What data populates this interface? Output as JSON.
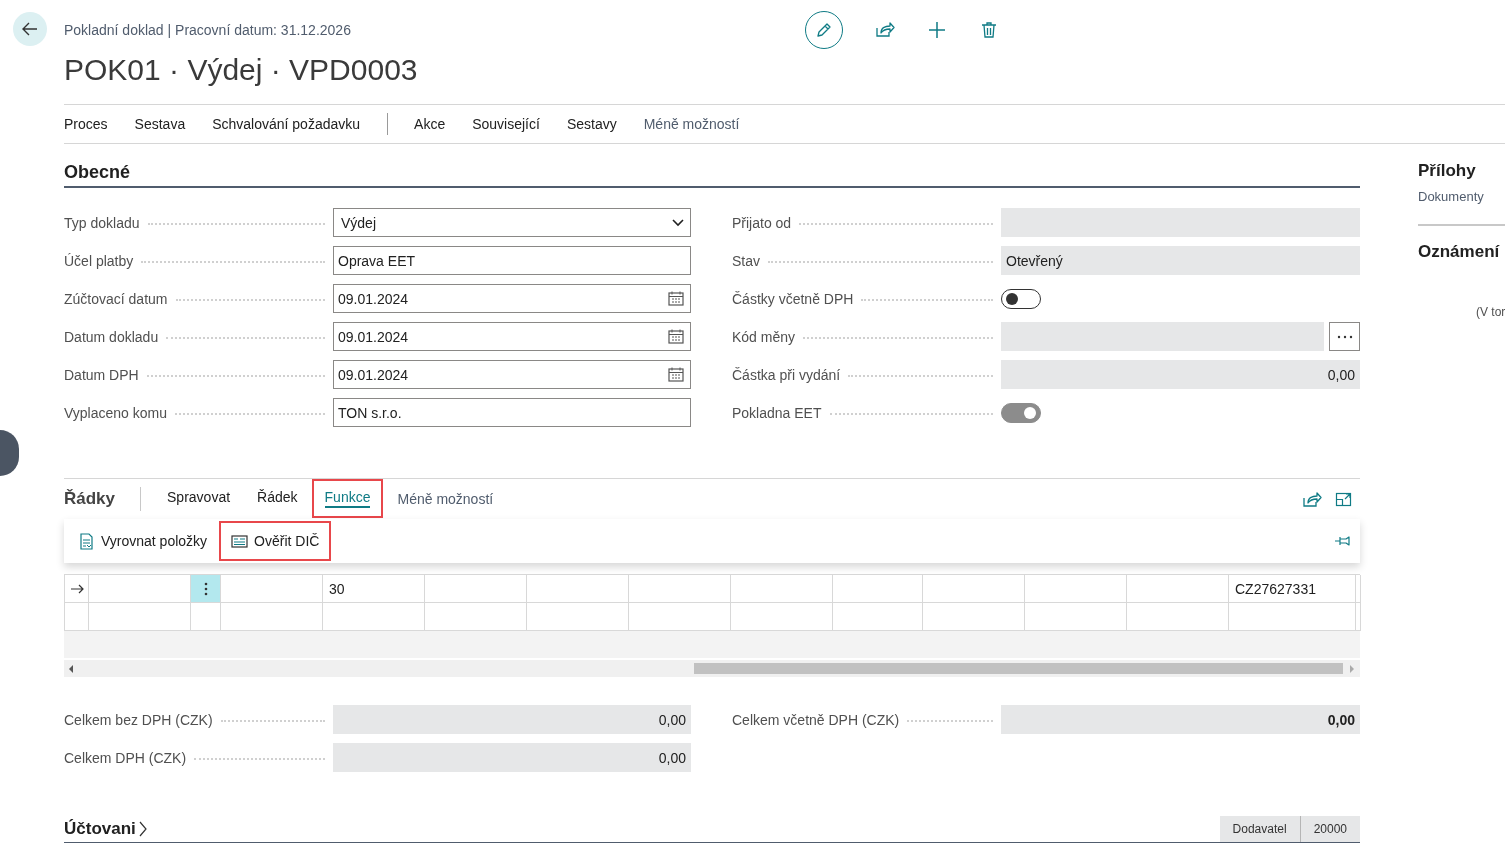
{
  "header": {
    "breadcrumb": "Pokladní doklad | Pracovní datum: 31.12.2026",
    "title": "POK01 · Výdej · VPD0003"
  },
  "action_bar": {
    "groups": [
      [
        "Proces",
        "Sestava",
        "Schvalování požadavku"
      ],
      [
        "Akce",
        "Související",
        "Sestavy"
      ]
    ],
    "less_options": "Méně možností"
  },
  "general": {
    "title": "Obecné",
    "left_fields": [
      {
        "label": "Typ dokladu",
        "kind": "dropdown",
        "value": "Výdej"
      },
      {
        "label": "Účel platby",
        "kind": "text",
        "value": "Oprava EET"
      },
      {
        "label": "Zúčtovací datum",
        "kind": "date",
        "value": "09.01.2024"
      },
      {
        "label": "Datum dokladu",
        "kind": "date",
        "value": "09.01.2024"
      },
      {
        "label": "Datum DPH",
        "kind": "date",
        "value": "09.01.2024"
      },
      {
        "label": "Vyplaceno komu",
        "kind": "text",
        "value": "TON s.r.o."
      }
    ],
    "right_fields": [
      {
        "label": "Přijato od",
        "kind": "readonly"
      },
      {
        "label": "Stav",
        "kind": "readonly",
        "value": "Otevřený"
      },
      {
        "label": "Částky včetně DPH",
        "kind": "toggle",
        "on": false,
        "disabled": false
      },
      {
        "label": "Kód měny",
        "kind": "lookup"
      },
      {
        "label": "Částka při vydání",
        "kind": "number",
        "value": "0,00"
      },
      {
        "label": "Pokladna EET",
        "kind": "toggle",
        "on": true,
        "disabled": true
      }
    ]
  },
  "lines": {
    "title": "Řádky",
    "tabs": [
      {
        "label": "Spravovat",
        "selected": false,
        "highlighted": false
      },
      {
        "label": "Řádek",
        "selected": false,
        "highlighted": false
      },
      {
        "label": "Funkce",
        "selected": true,
        "highlighted": true
      }
    ],
    "less_options": "Méně možností",
    "menu": [
      {
        "label": "Vyrovnat položky",
        "highlighted": false
      },
      {
        "label": "Ověřit DIČ",
        "highlighted": true
      }
    ],
    "rows": [
      {
        "current": true,
        "column_4": "30",
        "column_13": "CZ27627331"
      },
      {
        "current": false
      }
    ]
  },
  "totals": {
    "left": [
      {
        "label": "Celkem bez DPH (CZK)",
        "value": "0,00",
        "bold": false
      },
      {
        "label": "Celkem DPH (CZK)",
        "value": "0,00",
        "bold": false
      }
    ],
    "right": [
      {
        "label": "Celkem včetně DPH (CZK)",
        "value": "0,00",
        "bold": true
      }
    ]
  },
  "posting": {
    "title": "Účtovani",
    "summary": [
      "Dodavatel",
      "20000"
    ]
  },
  "factbox": {
    "attachments_title": "Přílohy",
    "attachments_link": "Dokumenty",
    "notifications_title": "Oznámení",
    "note": "(V tor"
  }
}
